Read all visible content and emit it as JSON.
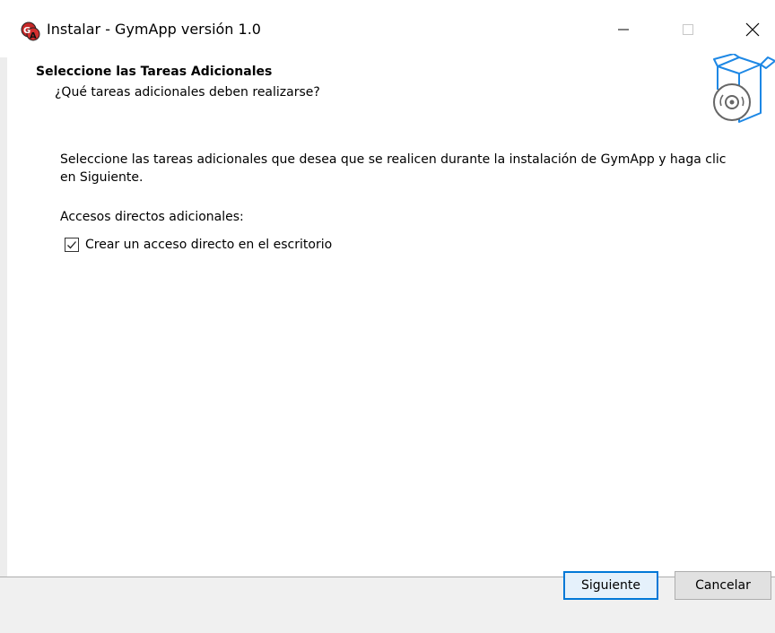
{
  "window": {
    "title": "Instalar - GymApp versión 1.0",
    "icon": "gymapp-installer-icon",
    "controls": [
      "minimize-icon",
      "maximize-icon",
      "close-icon"
    ]
  },
  "header": {
    "title": "Seleccione las Tareas Adicionales",
    "subtitle": "¿Qué tareas adicionales deben realizarse?",
    "image_icon": "box-with-disc-icon"
  },
  "body": {
    "description": "Seleccione las tareas adicionales que desea que se realicen durante la instalación de GymApp y haga clic en Siguiente.",
    "group_label": "Accesos directos adicionales:",
    "tasks": [
      {
        "label": "Crear un acceso directo en el escritorio",
        "checked": true
      }
    ]
  },
  "footer": {
    "next_label": "Siguiente",
    "cancel_label": "Cancelar"
  },
  "colors": {
    "accent": "#0078d7",
    "footer_bg": "#f0f0f0",
    "button_bg": "#e1e1e1",
    "icon_blue": "#1e88e5"
  }
}
